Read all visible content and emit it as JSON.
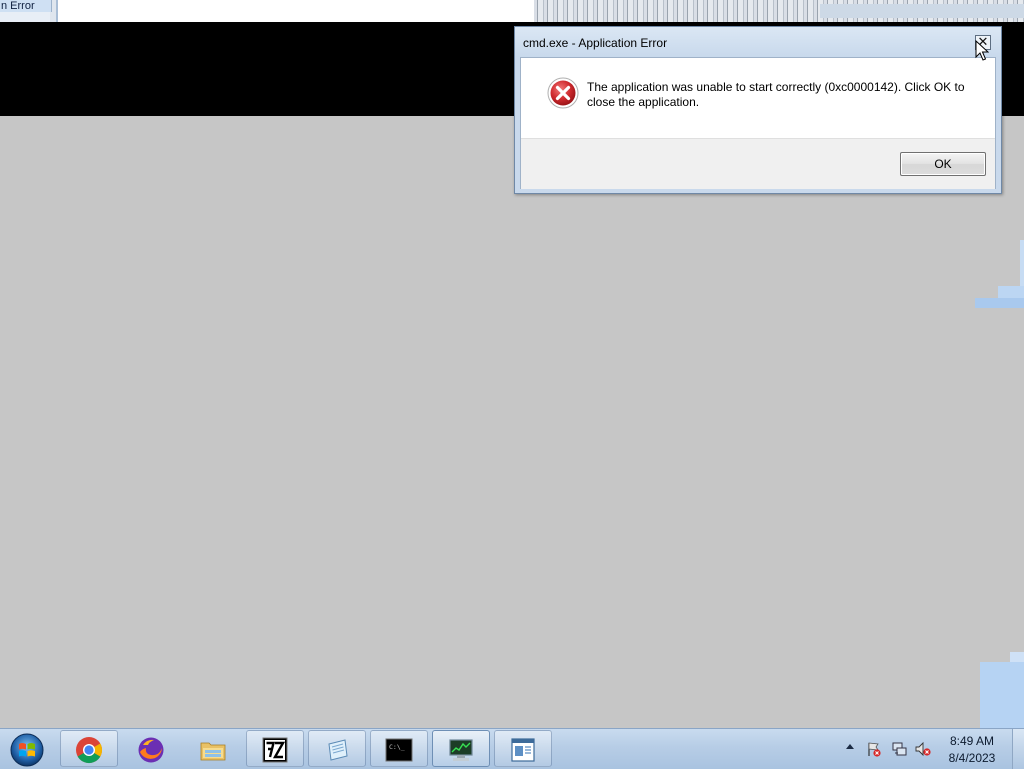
{
  "background_window": {
    "title_fragment": "n Error"
  },
  "dialog": {
    "title": "cmd.exe - Application Error",
    "close_label": "✕",
    "icon": "error-icon",
    "message": "The application was unable to start correctly (0xc0000142). Click OK to close the application.",
    "ok_label": "OK"
  },
  "taskbar": {
    "start_icon": "windows-start-icon",
    "apps": [
      {
        "name": "Google Chrome",
        "icon": "chrome-icon"
      },
      {
        "name": "Firefox",
        "icon": "firefox-icon"
      },
      {
        "name": "Windows Explorer",
        "icon": "folder-icon"
      },
      {
        "name": "7-Zip",
        "icon": "7zip-icon"
      },
      {
        "name": "Notepad",
        "icon": "notepad-icon"
      },
      {
        "name": "Command Prompt",
        "icon": "cmd-icon"
      },
      {
        "name": "Task Manager",
        "icon": "task-manager-icon"
      },
      {
        "name": "Document",
        "icon": "document-window-icon"
      }
    ],
    "tray": {
      "icons": [
        "action-center-flag-icon",
        "network-icon",
        "volume-muted-icon"
      ],
      "time": "8:49 AM",
      "date": "8/4/2023"
    }
  },
  "colors": {
    "desktop": "#c6c6c6",
    "taskbar": "#b7cde6",
    "error_red": "#c8262b"
  }
}
